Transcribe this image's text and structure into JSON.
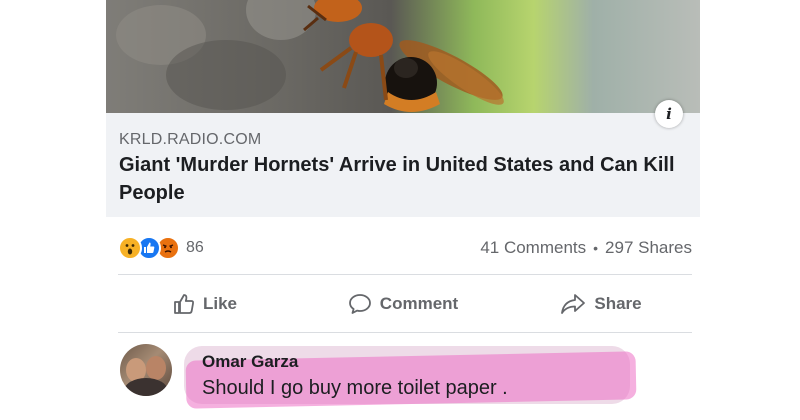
{
  "post": {
    "preview": {
      "image": "asian-giant-hornet-on-tree-bark",
      "info_icon": "info-icon"
    },
    "domain": "KRLD.RADIO.COM",
    "headline": "Giant 'Murder Hornets' Arrive in United States and Can Kill People",
    "reactions": {
      "icons": [
        "wow-emoji",
        "like-emoji",
        "angry-emoji"
      ],
      "count": "86"
    },
    "comments_count": "41 Comments",
    "separator": "•",
    "shares_count": "297 Shares"
  },
  "actions": {
    "like": "Like",
    "comment": "Comment",
    "share": "Share"
  },
  "comment": {
    "author": "Omar Garza",
    "text": "Should I go buy more toilet paper .",
    "highlight_color": "#ec70c4"
  },
  "colors": {
    "text_primary": "#1c1e21",
    "text_secondary": "#65676b",
    "caption_bg": "#f0f2f5",
    "like_blue": "#1877f2",
    "angry_orange": "#e9710f",
    "wow_yellow": "#f7b125"
  }
}
